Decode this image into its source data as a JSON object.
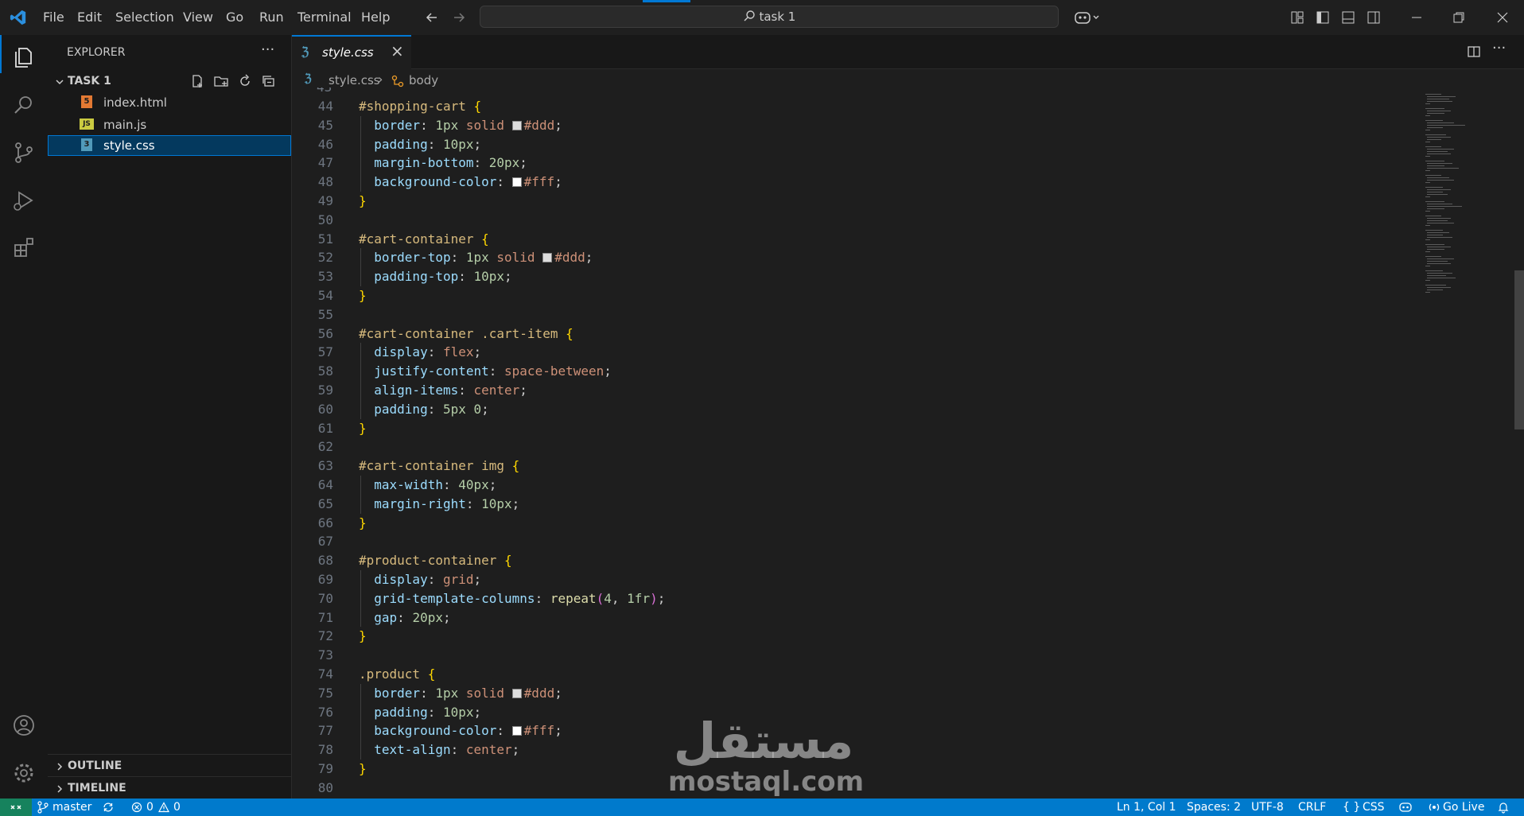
{
  "menu": [
    "File",
    "Edit",
    "Selection",
    "View",
    "Go",
    "Run",
    "Terminal",
    "Help"
  ],
  "search": {
    "text": "task 1"
  },
  "sidebar": {
    "title": "EXPLORER",
    "folder": "TASK 1",
    "files": [
      {
        "name": "index.html",
        "icon": "html-file-icon",
        "badge": "5",
        "color": "#e37933"
      },
      {
        "name": "main.js",
        "icon": "js-file-icon",
        "badge": "JS",
        "color": "#cbcb41"
      },
      {
        "name": "style.css",
        "icon": "css-file-icon",
        "badge": "3",
        "color": "#519aba"
      }
    ],
    "outline": "OUTLINE",
    "timeline": "TIMELINE"
  },
  "tab": {
    "label": "style.css",
    "close": "×"
  },
  "breadcrumb": {
    "file": "style.css",
    "symbol": "body"
  },
  "code": [
    {
      "n": "44",
      "toks": [
        [
          "sel",
          "#shopping-cart "
        ],
        [
          "br",
          "{"
        ]
      ]
    },
    {
      "n": "45",
      "toks": [
        [
          "prop",
          "  border"
        ],
        [
          "pun",
          ": "
        ],
        [
          "num",
          "1px"
        ],
        [
          "kw",
          " solid "
        ],
        [
          "sw",
          "#dddddd"
        ],
        [
          "kw",
          "#ddd"
        ],
        [
          "pun",
          ";"
        ]
      ]
    },
    {
      "n": "46",
      "toks": [
        [
          "prop",
          "  padding"
        ],
        [
          "pun",
          ": "
        ],
        [
          "num",
          "10px"
        ],
        [
          "pun",
          ";"
        ]
      ]
    },
    {
      "n": "47",
      "toks": [
        [
          "prop",
          "  margin-bottom"
        ],
        [
          "pun",
          ": "
        ],
        [
          "num",
          "20px"
        ],
        [
          "pun",
          ";"
        ]
      ]
    },
    {
      "n": "48",
      "toks": [
        [
          "prop",
          "  background-color"
        ],
        [
          "pun",
          ": "
        ],
        [
          "sw",
          "#ffffff"
        ],
        [
          "kw",
          "#fff"
        ],
        [
          "pun",
          ";"
        ]
      ]
    },
    {
      "n": "49",
      "toks": [
        [
          "br",
          "}"
        ]
      ]
    },
    {
      "n": "50",
      "toks": []
    },
    {
      "n": "51",
      "toks": [
        [
          "sel",
          "#cart-container "
        ],
        [
          "br",
          "{"
        ]
      ]
    },
    {
      "n": "52",
      "toks": [
        [
          "prop",
          "  border-top"
        ],
        [
          "pun",
          ": "
        ],
        [
          "num",
          "1px"
        ],
        [
          "kw",
          " solid "
        ],
        [
          "sw",
          "#dddddd"
        ],
        [
          "kw",
          "#ddd"
        ],
        [
          "pun",
          ";"
        ]
      ]
    },
    {
      "n": "53",
      "toks": [
        [
          "prop",
          "  padding-top"
        ],
        [
          "pun",
          ": "
        ],
        [
          "num",
          "10px"
        ],
        [
          "pun",
          ";"
        ]
      ]
    },
    {
      "n": "54",
      "toks": [
        [
          "br",
          "}"
        ]
      ]
    },
    {
      "n": "55",
      "toks": []
    },
    {
      "n": "56",
      "toks": [
        [
          "sel",
          "#cart-container .cart-item "
        ],
        [
          "br",
          "{"
        ]
      ]
    },
    {
      "n": "57",
      "toks": [
        [
          "prop",
          "  display"
        ],
        [
          "pun",
          ": "
        ],
        [
          "kw",
          "flex"
        ],
        [
          "pun",
          ";"
        ]
      ]
    },
    {
      "n": "58",
      "toks": [
        [
          "prop",
          "  justify-content"
        ],
        [
          "pun",
          ": "
        ],
        [
          "kw",
          "space-between"
        ],
        [
          "pun",
          ";"
        ]
      ]
    },
    {
      "n": "59",
      "toks": [
        [
          "prop",
          "  align-items"
        ],
        [
          "pun",
          ": "
        ],
        [
          "kw",
          "center"
        ],
        [
          "pun",
          ";"
        ]
      ]
    },
    {
      "n": "60",
      "toks": [
        [
          "prop",
          "  padding"
        ],
        [
          "pun",
          ": "
        ],
        [
          "num",
          "5px 0"
        ],
        [
          "pun",
          ";"
        ]
      ]
    },
    {
      "n": "61",
      "toks": [
        [
          "br",
          "}"
        ]
      ]
    },
    {
      "n": "62",
      "toks": []
    },
    {
      "n": "63",
      "toks": [
        [
          "sel",
          "#cart-container img "
        ],
        [
          "br",
          "{"
        ]
      ]
    },
    {
      "n": "64",
      "toks": [
        [
          "prop",
          "  max-width"
        ],
        [
          "pun",
          ": "
        ],
        [
          "num",
          "40px"
        ],
        [
          "pun",
          ";"
        ]
      ]
    },
    {
      "n": "65",
      "toks": [
        [
          "prop",
          "  margin-right"
        ],
        [
          "pun",
          ": "
        ],
        [
          "num",
          "10px"
        ],
        [
          "pun",
          ";"
        ]
      ]
    },
    {
      "n": "66",
      "toks": [
        [
          "br",
          "}"
        ]
      ]
    },
    {
      "n": "67",
      "toks": []
    },
    {
      "n": "68",
      "toks": [
        [
          "sel",
          "#product-container "
        ],
        [
          "br",
          "{"
        ]
      ]
    },
    {
      "n": "69",
      "toks": [
        [
          "prop",
          "  display"
        ],
        [
          "pun",
          ": "
        ],
        [
          "kw",
          "grid"
        ],
        [
          "pun",
          ";"
        ]
      ]
    },
    {
      "n": "70",
      "toks": [
        [
          "prop",
          "  grid-template-columns"
        ],
        [
          "pun",
          ": "
        ],
        [
          "fn",
          "repeat"
        ],
        [
          "br2",
          "("
        ],
        [
          "num",
          "4"
        ],
        [
          "pun",
          ", "
        ],
        [
          "num",
          "1fr"
        ],
        [
          "br2",
          ")"
        ],
        [
          "pun",
          ";"
        ]
      ]
    },
    {
      "n": "71",
      "toks": [
        [
          "prop",
          "  gap"
        ],
        [
          "pun",
          ": "
        ],
        [
          "num",
          "20px"
        ],
        [
          "pun",
          ";"
        ]
      ]
    },
    {
      "n": "72",
      "toks": [
        [
          "br",
          "}"
        ]
      ]
    },
    {
      "n": "73",
      "toks": []
    },
    {
      "n": "74",
      "toks": [
        [
          "sel",
          ".product "
        ],
        [
          "br",
          "{"
        ]
      ]
    },
    {
      "n": "75",
      "toks": [
        [
          "prop",
          "  border"
        ],
        [
          "pun",
          ": "
        ],
        [
          "num",
          "1px"
        ],
        [
          "kw",
          " solid "
        ],
        [
          "sw",
          "#dddddd"
        ],
        [
          "kw",
          "#ddd"
        ],
        [
          "pun",
          ";"
        ]
      ]
    },
    {
      "n": "76",
      "toks": [
        [
          "prop",
          "  padding"
        ],
        [
          "pun",
          ": "
        ],
        [
          "num",
          "10px"
        ],
        [
          "pun",
          ";"
        ]
      ]
    },
    {
      "n": "77",
      "toks": [
        [
          "prop",
          "  background-color"
        ],
        [
          "pun",
          ": "
        ],
        [
          "sw",
          "#ffffff"
        ],
        [
          "kw",
          "#fff"
        ],
        [
          "pun",
          ";"
        ]
      ]
    },
    {
      "n": "78",
      "toks": [
        [
          "prop",
          "  text-align"
        ],
        [
          "pun",
          ": "
        ],
        [
          "kw",
          "center"
        ],
        [
          "pun",
          ";"
        ]
      ]
    },
    {
      "n": "79",
      "toks": [
        [
          "br",
          "}"
        ]
      ]
    },
    {
      "n": "80",
      "toks": []
    }
  ],
  "status": {
    "branch": "master",
    "errors": "0",
    "warnings": "0",
    "position": "Ln 1, Col 1",
    "spaces": "Spaces: 2",
    "encoding": "UTF-8",
    "eol": "CRLF",
    "language": "CSS",
    "golive": "Go Live"
  },
  "watermark": {
    "arabic": "مستقل",
    "latin": "mostaql.com"
  },
  "colors": {
    "accent": "#0078d4",
    "statusbar": "#007acc"
  }
}
